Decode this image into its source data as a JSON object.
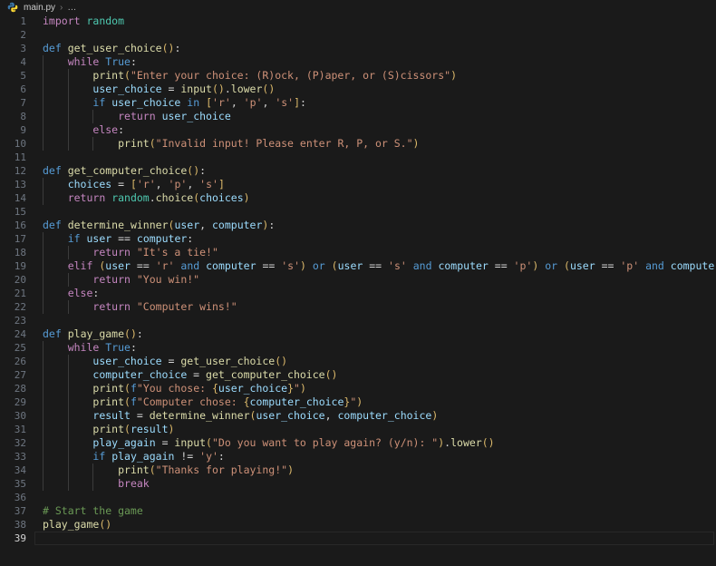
{
  "breadcrumb": {
    "icon": "python-file-icon",
    "file": "main.py",
    "separator": "›",
    "more": "…"
  },
  "editor": {
    "language": "Python",
    "total_lines": 39,
    "current_line": 39,
    "tab_size": 4,
    "theme": "dark-plus",
    "colors": {
      "background": "#1a1a1a",
      "foreground": "#d4d4d4",
      "line_number": "#6e7681",
      "line_number_active": "#d4d4d4",
      "keyword_magenta": "#C586C0",
      "keyword_blue": "#569CD6",
      "function": "#DCDCAA",
      "variable": "#9CDCFE",
      "class_module": "#4EC9B0",
      "string": "#CE9178",
      "comment": "#6A9955",
      "bracket_1": "#DDBA6B",
      "bracket_2": "#C586C0",
      "bracket_3": "#569CD6",
      "indent_guide": "#3b3b3b",
      "current_line_border": "#282828"
    },
    "lines": [
      {
        "n": 1,
        "indent": 0,
        "text": "import random"
      },
      {
        "n": 2,
        "indent": 0,
        "text": ""
      },
      {
        "n": 3,
        "indent": 0,
        "text": "def get_user_choice():"
      },
      {
        "n": 4,
        "indent": 1,
        "text": "while True:"
      },
      {
        "n": 5,
        "indent": 2,
        "text": "print(\"Enter your choice: (R)ock, (P)aper, or (S)cissors\")"
      },
      {
        "n": 6,
        "indent": 2,
        "text": "user_choice = input().lower()"
      },
      {
        "n": 7,
        "indent": 2,
        "text": "if user_choice in ['r', 'p', 's']:"
      },
      {
        "n": 8,
        "indent": 3,
        "text": "return user_choice"
      },
      {
        "n": 9,
        "indent": 2,
        "text": "else:"
      },
      {
        "n": 10,
        "indent": 3,
        "text": "print(\"Invalid input! Please enter R, P, or S.\")"
      },
      {
        "n": 11,
        "indent": 0,
        "text": ""
      },
      {
        "n": 12,
        "indent": 0,
        "text": "def get_computer_choice():"
      },
      {
        "n": 13,
        "indent": 1,
        "text": "choices = ['r', 'p', 's']"
      },
      {
        "n": 14,
        "indent": 1,
        "text": "return random.choice(choices)"
      },
      {
        "n": 15,
        "indent": 0,
        "text": ""
      },
      {
        "n": 16,
        "indent": 0,
        "text": "def determine_winner(user, computer):"
      },
      {
        "n": 17,
        "indent": 1,
        "text": "if user == computer:"
      },
      {
        "n": 18,
        "indent": 2,
        "text": "return \"It's a tie!\""
      },
      {
        "n": 19,
        "indent": 1,
        "text": "elif (user == 'r' and computer == 's') or (user == 's' and computer == 'p') or (user == 'p' and computer == 'r'):"
      },
      {
        "n": 20,
        "indent": 2,
        "text": "return \"You win!\""
      },
      {
        "n": 21,
        "indent": 1,
        "text": "else:"
      },
      {
        "n": 22,
        "indent": 2,
        "text": "return \"Computer wins!\""
      },
      {
        "n": 23,
        "indent": 0,
        "text": ""
      },
      {
        "n": 24,
        "indent": 0,
        "text": "def play_game():"
      },
      {
        "n": 25,
        "indent": 1,
        "text": "while True:"
      },
      {
        "n": 26,
        "indent": 2,
        "text": "user_choice = get_user_choice()"
      },
      {
        "n": 27,
        "indent": 2,
        "text": "computer_choice = get_computer_choice()"
      },
      {
        "n": 28,
        "indent": 2,
        "text": "print(f\"You chose: {user_choice}\")"
      },
      {
        "n": 29,
        "indent": 2,
        "text": "print(f\"Computer chose: {computer_choice}\")"
      },
      {
        "n": 30,
        "indent": 2,
        "text": "result = determine_winner(user_choice, computer_choice)"
      },
      {
        "n": 31,
        "indent": 2,
        "text": "print(result)"
      },
      {
        "n": 32,
        "indent": 2,
        "text": "play_again = input(\"Do you want to play again? (y/n): \").lower()"
      },
      {
        "n": 33,
        "indent": 2,
        "text": "if play_again != 'y':"
      },
      {
        "n": 34,
        "indent": 3,
        "text": "print(\"Thanks for playing!\")"
      },
      {
        "n": 35,
        "indent": 3,
        "text": "break"
      },
      {
        "n": 36,
        "indent": 0,
        "text": ""
      },
      {
        "n": 37,
        "indent": 0,
        "text": "# Start the game"
      },
      {
        "n": 38,
        "indent": 0,
        "text": "play_game()"
      },
      {
        "n": 39,
        "indent": 0,
        "text": ""
      }
    ],
    "tokens": {
      "1": [
        [
          "kw",
          "import"
        ],
        [
          "op",
          " "
        ],
        [
          "cls",
          "random"
        ]
      ],
      "3": [
        [
          "kw2",
          "def"
        ],
        [
          "op",
          " "
        ],
        [
          "fn",
          "get_user_choice"
        ],
        [
          "p1",
          "()"
        ],
        [
          "op",
          ":"
        ]
      ],
      "4": [
        [
          "kw",
          "while"
        ],
        [
          "op",
          " "
        ],
        [
          "kw2",
          "True"
        ],
        [
          "op",
          ":"
        ]
      ],
      "5": [
        [
          "fn",
          "print"
        ],
        [
          "p1",
          "("
        ],
        [
          "str",
          "\"Enter your choice: (R)ock, (P)aper, or (S)cissors\""
        ],
        [
          "p1",
          ")"
        ]
      ],
      "6": [
        [
          "var",
          "user_choice"
        ],
        [
          "op",
          " = "
        ],
        [
          "fn",
          "input"
        ],
        [
          "p1",
          "()"
        ],
        [
          "op",
          "."
        ],
        [
          "fn",
          "lower"
        ],
        [
          "p1",
          "()"
        ]
      ],
      "7": [
        [
          "kw2",
          "if"
        ],
        [
          "op",
          " "
        ],
        [
          "var",
          "user_choice"
        ],
        [
          "op",
          " "
        ],
        [
          "kw2",
          "in"
        ],
        [
          "op",
          " "
        ],
        [
          "p1",
          "["
        ],
        [
          "str",
          "'r'"
        ],
        [
          "op",
          ", "
        ],
        [
          "str",
          "'p'"
        ],
        [
          "op",
          ", "
        ],
        [
          "str",
          "'s'"
        ],
        [
          "p1",
          "]"
        ],
        [
          "op",
          ":"
        ]
      ],
      "8": [
        [
          "kw",
          "return"
        ],
        [
          "op",
          " "
        ],
        [
          "var",
          "user_choice"
        ]
      ],
      "9": [
        [
          "kw",
          "else"
        ],
        [
          "op",
          ":"
        ]
      ],
      "10": [
        [
          "fn",
          "print"
        ],
        [
          "p1",
          "("
        ],
        [
          "str",
          "\"Invalid input! Please enter R, P, or S.\""
        ],
        [
          "p1",
          ")"
        ]
      ],
      "12": [
        [
          "kw2",
          "def"
        ],
        [
          "op",
          " "
        ],
        [
          "fn",
          "get_computer_choice"
        ],
        [
          "p1",
          "()"
        ],
        [
          "op",
          ":"
        ]
      ],
      "13": [
        [
          "var",
          "choices"
        ],
        [
          "op",
          " = "
        ],
        [
          "p1",
          "["
        ],
        [
          "str",
          "'r'"
        ],
        [
          "op",
          ", "
        ],
        [
          "str",
          "'p'"
        ],
        [
          "op",
          ", "
        ],
        [
          "str",
          "'s'"
        ],
        [
          "p1",
          "]"
        ]
      ],
      "14": [
        [
          "kw",
          "return"
        ],
        [
          "op",
          " "
        ],
        [
          "cls",
          "random"
        ],
        [
          "op",
          "."
        ],
        [
          "fn",
          "choice"
        ],
        [
          "p1",
          "("
        ],
        [
          "var",
          "choices"
        ],
        [
          "p1",
          ")"
        ]
      ],
      "16": [
        [
          "kw2",
          "def"
        ],
        [
          "op",
          " "
        ],
        [
          "fn",
          "determine_winner"
        ],
        [
          "p1",
          "("
        ],
        [
          "var",
          "user"
        ],
        [
          "op",
          ", "
        ],
        [
          "var",
          "computer"
        ],
        [
          "p1",
          ")"
        ],
        [
          "op",
          ":"
        ]
      ],
      "17": [
        [
          "kw2",
          "if"
        ],
        [
          "op",
          " "
        ],
        [
          "var",
          "user"
        ],
        [
          "op",
          " == "
        ],
        [
          "var",
          "computer"
        ],
        [
          "op",
          ":"
        ]
      ],
      "18": [
        [
          "kw",
          "return"
        ],
        [
          "op",
          " "
        ],
        [
          "str",
          "\"It's a tie!\""
        ]
      ],
      "19": [
        [
          "kw",
          "elif"
        ],
        [
          "op",
          " "
        ],
        [
          "p1",
          "("
        ],
        [
          "var",
          "user"
        ],
        [
          "op",
          " == "
        ],
        [
          "str",
          "'r'"
        ],
        [
          "op",
          " "
        ],
        [
          "kw2",
          "and"
        ],
        [
          "op",
          " "
        ],
        [
          "var",
          "computer"
        ],
        [
          "op",
          " == "
        ],
        [
          "str",
          "'s'"
        ],
        [
          "p1",
          ")"
        ],
        [
          "op",
          " "
        ],
        [
          "kw2",
          "or"
        ],
        [
          "op",
          " "
        ],
        [
          "p1",
          "("
        ],
        [
          "var",
          "user"
        ],
        [
          "op",
          " == "
        ],
        [
          "str",
          "'s'"
        ],
        [
          "op",
          " "
        ],
        [
          "kw2",
          "and"
        ],
        [
          "op",
          " "
        ],
        [
          "var",
          "computer"
        ],
        [
          "op",
          " == "
        ],
        [
          "str",
          "'p'"
        ],
        [
          "p1",
          ")"
        ],
        [
          "op",
          " "
        ],
        [
          "kw2",
          "or"
        ],
        [
          "op",
          " "
        ],
        [
          "p1",
          "("
        ],
        [
          "var",
          "user"
        ],
        [
          "op",
          " == "
        ],
        [
          "str",
          "'p'"
        ],
        [
          "op",
          " "
        ],
        [
          "kw2",
          "and"
        ],
        [
          "op",
          " "
        ],
        [
          "var",
          "computer"
        ],
        [
          "op",
          " == "
        ],
        [
          "str",
          "'r'"
        ],
        [
          "p1",
          ")"
        ],
        [
          "op",
          ":"
        ]
      ],
      "20": [
        [
          "kw",
          "return"
        ],
        [
          "op",
          " "
        ],
        [
          "str",
          "\"You win!\""
        ]
      ],
      "21": [
        [
          "kw",
          "else"
        ],
        [
          "op",
          ":"
        ]
      ],
      "22": [
        [
          "kw",
          "return"
        ],
        [
          "op",
          " "
        ],
        [
          "str",
          "\"Computer wins!\""
        ]
      ],
      "24": [
        [
          "kw2",
          "def"
        ],
        [
          "op",
          " "
        ],
        [
          "fn",
          "play_game"
        ],
        [
          "p1",
          "()"
        ],
        [
          "op",
          ":"
        ]
      ],
      "25": [
        [
          "kw",
          "while"
        ],
        [
          "op",
          " "
        ],
        [
          "kw2",
          "True"
        ],
        [
          "op",
          ":"
        ]
      ],
      "26": [
        [
          "var",
          "user_choice"
        ],
        [
          "op",
          " = "
        ],
        [
          "fn",
          "get_user_choice"
        ],
        [
          "p1",
          "()"
        ]
      ],
      "27": [
        [
          "var",
          "computer_choice"
        ],
        [
          "op",
          " = "
        ],
        [
          "fn",
          "get_computer_choice"
        ],
        [
          "p1",
          "()"
        ]
      ],
      "28": [
        [
          "fn",
          "print"
        ],
        [
          "p1",
          "("
        ],
        [
          "kw2",
          "f"
        ],
        [
          "str",
          "\"You chose: "
        ],
        [
          "p1",
          "{"
        ],
        [
          "var",
          "user_choice"
        ],
        [
          "p1",
          "}"
        ],
        [
          "str",
          "\""
        ],
        [
          "p1",
          ")"
        ]
      ],
      "29": [
        [
          "fn",
          "print"
        ],
        [
          "p1",
          "("
        ],
        [
          "kw2",
          "f"
        ],
        [
          "str",
          "\"Computer chose: "
        ],
        [
          "p1",
          "{"
        ],
        [
          "var",
          "computer_choice"
        ],
        [
          "p1",
          "}"
        ],
        [
          "str",
          "\""
        ],
        [
          "p1",
          ")"
        ]
      ],
      "30": [
        [
          "var",
          "result"
        ],
        [
          "op",
          " = "
        ],
        [
          "fn",
          "determine_winner"
        ],
        [
          "p1",
          "("
        ],
        [
          "var",
          "user_choice"
        ],
        [
          "op",
          ", "
        ],
        [
          "var",
          "computer_choice"
        ],
        [
          "p1",
          ")"
        ]
      ],
      "31": [
        [
          "fn",
          "print"
        ],
        [
          "p1",
          "("
        ],
        [
          "var",
          "result"
        ],
        [
          "p1",
          ")"
        ]
      ],
      "32": [
        [
          "var",
          "play_again"
        ],
        [
          "op",
          " = "
        ],
        [
          "fn",
          "input"
        ],
        [
          "p1",
          "("
        ],
        [
          "str",
          "\"Do you want to play again? (y/n): \""
        ],
        [
          "p1",
          ")"
        ],
        [
          "op",
          "."
        ],
        [
          "fn",
          "lower"
        ],
        [
          "p1",
          "()"
        ]
      ],
      "33": [
        [
          "kw2",
          "if"
        ],
        [
          "op",
          " "
        ],
        [
          "var",
          "play_again"
        ],
        [
          "op",
          " != "
        ],
        [
          "str",
          "'y'"
        ],
        [
          "op",
          ":"
        ]
      ],
      "34": [
        [
          "fn",
          "print"
        ],
        [
          "p1",
          "("
        ],
        [
          "str",
          "\"Thanks for playing!\""
        ],
        [
          "p1",
          ")"
        ]
      ],
      "35": [
        [
          "kw",
          "break"
        ]
      ],
      "37": [
        [
          "cmt",
          "# Start the game"
        ]
      ],
      "38": [
        [
          "fn",
          "play_game"
        ],
        [
          "p1",
          "()"
        ]
      ]
    }
  }
}
